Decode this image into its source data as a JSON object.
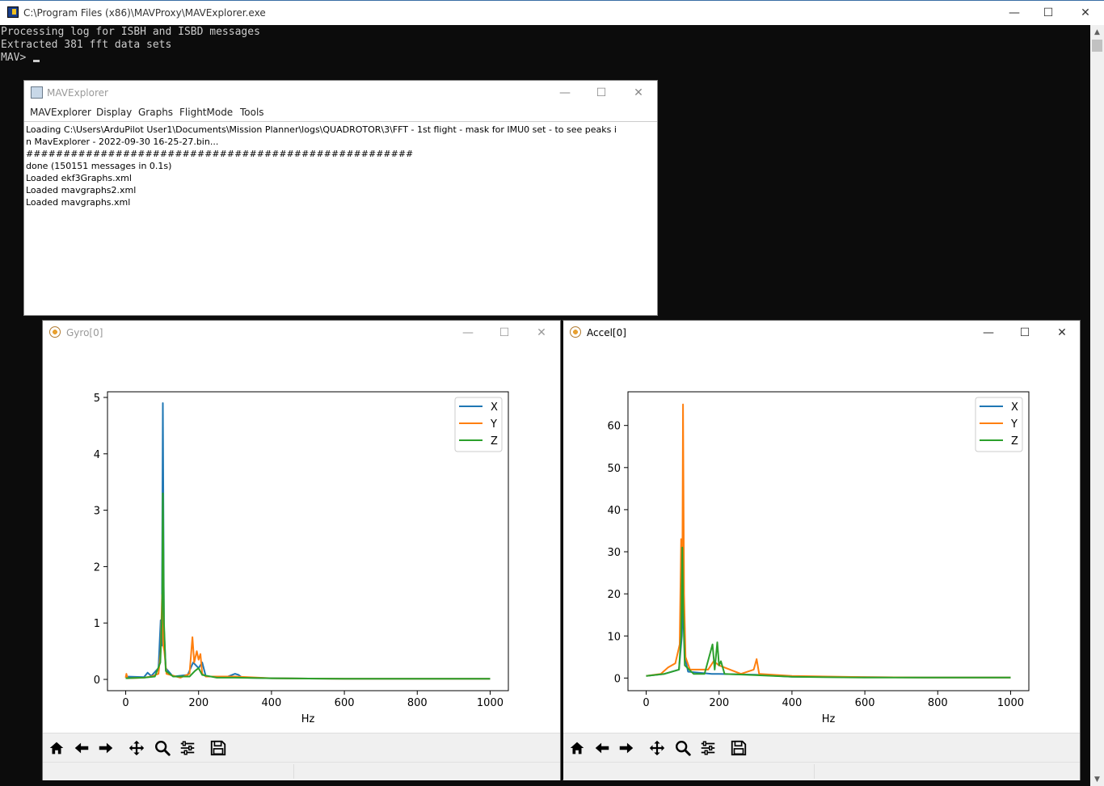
{
  "console": {
    "title": "C:\\Program Files (x86)\\MAVProxy\\MAVExplorer.exe",
    "lines": [
      "Processing log for ISBH and ISBD messages",
      "Extracted 381 fft data sets"
    ],
    "prompt": "MAV> "
  },
  "explorer": {
    "title": "MAVExplorer",
    "menu": [
      "MAVExplorer",
      "Display",
      "Graphs",
      "FlightMode",
      "Tools"
    ],
    "log": [
      "Loading C:\\Users\\ArduPilot User1\\Documents\\Mission Planner\\logs\\QUADROTOR\\3\\FFT - 1st flight - mask for IMU0 set - to see peaks in MavExplorer - 2022-09-30 16-25-27.bin...",
      "####################################################",
      "done (150151 messages in 0.1s)",
      "Loaded ekf3Graphs.xml",
      "Loaded mavgraphs2.xml",
      "Loaded mavgraphs.xml"
    ]
  },
  "windows": {
    "minimize_glyph": "—",
    "maximize_glyph": "☐",
    "close_glyph": "✕"
  },
  "colors": {
    "X": "#1f77b4",
    "Y": "#ff7f0e",
    "Z": "#2ca02c"
  },
  "toolbar_icons": [
    "home-icon",
    "back-arrow-icon",
    "forward-arrow-icon",
    "pan-icon",
    "zoom-icon",
    "configure-subplots-icon",
    "save-icon"
  ],
  "chart_data": [
    {
      "window_title": "Gyro[0]",
      "type": "line",
      "xlabel": "Hz",
      "ylabel": "",
      "xlim": [
        -50,
        1050
      ],
      "ylim": [
        -0.2,
        5.1
      ],
      "xticks": [
        0,
        200,
        400,
        600,
        800,
        1000
      ],
      "yticks": [
        0,
        1,
        2,
        3,
        4,
        5
      ],
      "legend": "top-right",
      "series": [
        {
          "name": "X",
          "points": [
            [
              0,
              0.05
            ],
            [
              50,
              0.04
            ],
            [
              60,
              0.12
            ],
            [
              70,
              0.06
            ],
            [
              90,
              0.2
            ],
            [
              96,
              1.05
            ],
            [
              99,
              0.6
            ],
            [
              102,
              4.9
            ],
            [
              105,
              0.9
            ],
            [
              110,
              0.2
            ],
            [
              130,
              0.05
            ],
            [
              170,
              0.08
            ],
            [
              185,
              0.3
            ],
            [
              200,
              0.2
            ],
            [
              210,
              0.3
            ],
            [
              220,
              0.05
            ],
            [
              280,
              0.05
            ],
            [
              300,
              0.1
            ],
            [
              310,
              0.08
            ],
            [
              320,
              0.03
            ],
            [
              400,
              0.02
            ],
            [
              600,
              0.01
            ],
            [
              800,
              0.01
            ],
            [
              1000,
              0.01
            ]
          ]
        },
        {
          "name": "Y",
          "points": [
            [
              0,
              0.03
            ],
            [
              2,
              0.1
            ],
            [
              5,
              0.02
            ],
            [
              50,
              0.03
            ],
            [
              70,
              0.05
            ],
            [
              90,
              0.1
            ],
            [
              96,
              0.5
            ],
            [
              100,
              1.5
            ],
            [
              103,
              0.6
            ],
            [
              106,
              0.5
            ],
            [
              112,
              0.1
            ],
            [
              150,
              0.03
            ],
            [
              175,
              0.1
            ],
            [
              183,
              0.75
            ],
            [
              188,
              0.3
            ],
            [
              195,
              0.5
            ],
            [
              200,
              0.35
            ],
            [
              205,
              0.45
            ],
            [
              210,
              0.1
            ],
            [
              220,
              0.05
            ],
            [
              300,
              0.05
            ],
            [
              400,
              0.02
            ],
            [
              600,
              0.01
            ],
            [
              800,
              0.01
            ],
            [
              1000,
              0.01
            ]
          ]
        },
        {
          "name": "Z",
          "points": [
            [
              0,
              0.02
            ],
            [
              50,
              0.03
            ],
            [
              80,
              0.05
            ],
            [
              95,
              0.3
            ],
            [
              100,
              1.2
            ],
            [
              102,
              3.3
            ],
            [
              105,
              1.0
            ],
            [
              110,
              0.15
            ],
            [
              130,
              0.05
            ],
            [
              175,
              0.05
            ],
            [
              190,
              0.15
            ],
            [
              200,
              0.2
            ],
            [
              210,
              0.08
            ],
            [
              250,
              0.03
            ],
            [
              300,
              0.03
            ],
            [
              400,
              0.02
            ],
            [
              600,
              0.01
            ],
            [
              800,
              0.01
            ],
            [
              1000,
              0.01
            ]
          ]
        }
      ]
    },
    {
      "window_title": "Accel[0]",
      "type": "line",
      "xlabel": "Hz",
      "ylabel": "",
      "xlim": [
        -50,
        1050
      ],
      "ylim": [
        -3,
        68
      ],
      "xticks": [
        0,
        200,
        400,
        600,
        800,
        1000
      ],
      "yticks": [
        0,
        10,
        20,
        30,
        40,
        50,
        60
      ],
      "legend": "top-right",
      "series": [
        {
          "name": "X",
          "points": [
            [
              0,
              0.5
            ],
            [
              50,
              1.0
            ],
            [
              90,
              2
            ],
            [
              98,
              10
            ],
            [
              102,
              22
            ],
            [
              106,
              5
            ],
            [
              115,
              1.5
            ],
            [
              180,
              1
            ],
            [
              200,
              1
            ],
            [
              300,
              0.8
            ],
            [
              400,
              0.3
            ],
            [
              600,
              0.2
            ],
            [
              800,
              0.1
            ],
            [
              1000,
              0.1
            ]
          ]
        },
        {
          "name": "Y",
          "points": [
            [
              0,
              0.5
            ],
            [
              40,
              1
            ],
            [
              60,
              2.5
            ],
            [
              80,
              3.5
            ],
            [
              92,
              8
            ],
            [
              96,
              33
            ],
            [
              99,
              20
            ],
            [
              101,
              65
            ],
            [
              104,
              20
            ],
            [
              108,
              5
            ],
            [
              120,
              2
            ],
            [
              170,
              2
            ],
            [
              185,
              4
            ],
            [
              200,
              3
            ],
            [
              260,
              1
            ],
            [
              295,
              2
            ],
            [
              303,
              4.5
            ],
            [
              310,
              1
            ],
            [
              400,
              0.5
            ],
            [
              600,
              0.2
            ],
            [
              800,
              0.1
            ],
            [
              1000,
              0.1
            ]
          ]
        },
        {
          "name": "Z",
          "points": [
            [
              0,
              0.5
            ],
            [
              50,
              1
            ],
            [
              90,
              2
            ],
            [
              96,
              10
            ],
            [
              99,
              31
            ],
            [
              102,
              15
            ],
            [
              106,
              3
            ],
            [
              130,
              1
            ],
            [
              160,
              1
            ],
            [
              182,
              8
            ],
            [
              188,
              2
            ],
            [
              195,
              8.5
            ],
            [
              200,
              3
            ],
            [
              205,
              4
            ],
            [
              215,
              1
            ],
            [
              300,
              0.7
            ],
            [
              400,
              0.3
            ],
            [
              600,
              0.1
            ],
            [
              800,
              0.1
            ],
            [
              1000,
              0.1
            ]
          ]
        }
      ]
    }
  ]
}
